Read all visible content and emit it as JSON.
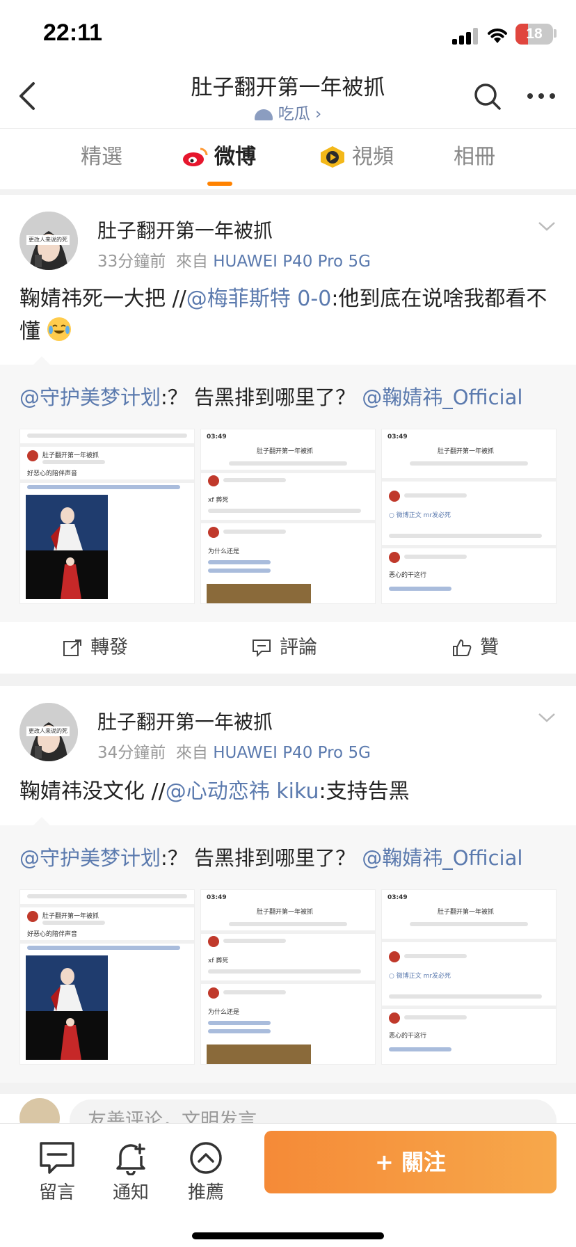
{
  "status_bar": {
    "time": "22:11",
    "battery": "18"
  },
  "header": {
    "title": "肚子翻开第一年被抓",
    "subtitle": "吃瓜 ›"
  },
  "tabs": [
    {
      "label": "精選",
      "active": false
    },
    {
      "label": "微博",
      "active": true
    },
    {
      "label": "視頻",
      "active": false
    },
    {
      "label": "相冊",
      "active": false
    }
  ],
  "posts": [
    {
      "author": "肚子翻开第一年被抓",
      "time": "33分鐘前",
      "source_prefix": "來自",
      "source": "HUAWEI P40 Pro 5G",
      "text_before": "鞠婧祎死一大把 //",
      "mention": "@梅菲斯特 0-0",
      "text_after": ":他到底在说啥我都看不懂",
      "emoji": "laughing-crying",
      "quote_mention": "@守护美梦计划",
      "quote_text": ":？ 告黑排到哪里了？ ",
      "quote_mention2": "@鞠婧祎_Official"
    },
    {
      "author": "肚子翻开第一年被抓",
      "time": "34分鐘前",
      "source_prefix": "來自",
      "source": "HUAWEI P40 Pro 5G",
      "text_before": "鞠婧祎没文化 //",
      "mention": "@心动恋祎 kiku",
      "text_after": ":支持告黑",
      "quote_mention": "@守护美梦计划",
      "quote_text": ":？ 告黑排到哪里了？ ",
      "quote_mention2": "@鞠婧祎_Official"
    }
  ],
  "actions": {
    "repost": "轉發",
    "comment": "評論",
    "like": "贊"
  },
  "avatar_badge": "更改人来说的死",
  "thumbs": {
    "a_title": "肚子翻开第一年被抓",
    "a_line1": "好恶心的陪伴声音",
    "b_line1": "xf 葬死",
    "b_line2": "为什么还是",
    "c_line1": "○ 微博正文 mr发必死",
    "c_line2": "恶心的干这行",
    "time": "03:49"
  },
  "comment_bar": {
    "placeholder": "友善评论，文明发言"
  },
  "bottom_bar": {
    "message": "留言",
    "notify": "通知",
    "recommend": "推薦",
    "follow": "+ 關注"
  },
  "colors": {
    "accent": "#ff8200",
    "link": "#5b7aae",
    "follow_start": "#f58a37",
    "follow_end": "#f7a84b"
  }
}
